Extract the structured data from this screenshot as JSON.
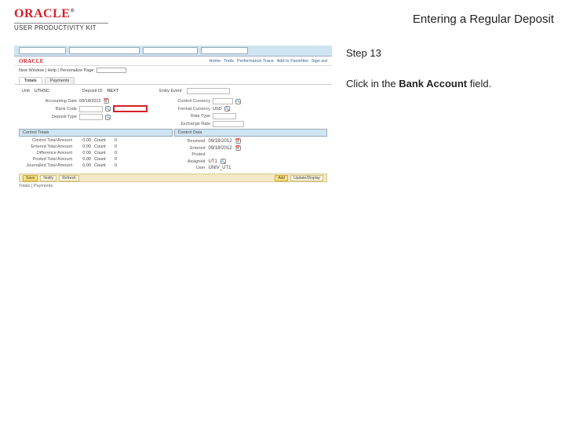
{
  "brand": {
    "logo": "ORACLE",
    "tm": "®",
    "sub": "USER PRODUCTIVITY KIT"
  },
  "title": "Entering a Regular Deposit",
  "instr": {
    "step": "Step 13",
    "pre": "Click in the ",
    "bold": "Bank Account",
    "post": " field."
  },
  "shot": {
    "logo": "ORACLE",
    "links": [
      "Home",
      "Tools",
      "Performance Trace",
      "Add to Favorites",
      "Sign out"
    ],
    "minilabel": "New Window | Help | Personalize Page",
    "tabs": [
      "Totals",
      "Payments"
    ],
    "row1": {
      "unitLabel": "Unit",
      "unitVal": "UTHSC",
      "depLabel": "Deposit ID",
      "depVal": "NEXT",
      "entryLabel": "Entry Event"
    },
    "left": {
      "r1": {
        "label": "Accounting Date",
        "val": "09/18/2012"
      },
      "r2": {
        "label": "Bank Code",
        "val": ""
      },
      "r3": {
        "label": "Deposit Type"
      }
    },
    "right": {
      "r1": {
        "label": "Control Currency"
      },
      "r2": {
        "label": "Format Currency",
        "val": "USD"
      },
      "r3": {
        "label": "Rate Type"
      },
      "r4": {
        "label": "Exchange Rate"
      }
    },
    "sec": {
      "left": "Control Totals",
      "right": "Control Data"
    },
    "ctl": {
      "rows": [
        {
          "label": "Control Total Amount",
          "num": "0.00",
          "cur": "Count",
          "z": "0"
        },
        {
          "label": "Entered Total Amount",
          "num": "0.00",
          "cur": "Count",
          "z": "0"
        },
        {
          "label": "Difference Amount",
          "num": "0.00",
          "cur": "Count",
          "z": "0"
        },
        {
          "label": "Posted Total Amount",
          "num": "0.00",
          "cur": "Count",
          "z": "0"
        },
        {
          "label": "Journalled Total Amount",
          "num": "0.00",
          "cur": "Count",
          "z": "0"
        }
      ]
    },
    "ctlright": {
      "r1": {
        "label": "Received",
        "val": "09/18/2012"
      },
      "r2": {
        "label": "Entered",
        "val": "09/18/2012"
      },
      "r3": {
        "label": "Posted"
      },
      "r4": {
        "label": "Assigned",
        "val": "UT1"
      },
      "r5": {
        "label": "User",
        "val": "UNIV_UT1"
      }
    },
    "buttons": {
      "save": "Save",
      "notify": "Notify",
      "refresh": "Refresh",
      "add": "Add",
      "update": "Update/Display"
    },
    "foot": "Totals | Payments"
  }
}
